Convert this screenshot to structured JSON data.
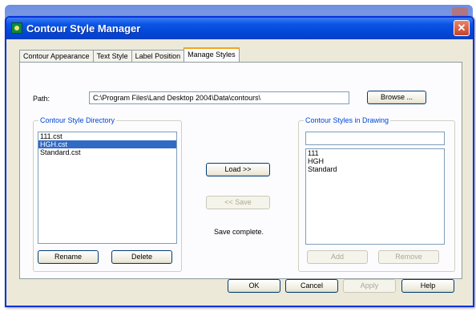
{
  "dialog": {
    "title": "Contour Style Manager",
    "close_glyph": "✕"
  },
  "tabs": [
    {
      "label": "Contour Appearance"
    },
    {
      "label": "Text Style"
    },
    {
      "label": "Label Position"
    },
    {
      "label": "Manage Styles"
    }
  ],
  "path": {
    "label": "Path:",
    "value": "C:\\Program Files\\Land Desktop 2004\\Data\\contours\\",
    "browse_label": "Browse ..."
  },
  "directory": {
    "title": "Contour Style Directory",
    "items": [
      "111.cst",
      "HGH.cst",
      "Standard.cst"
    ],
    "selected_index": 1,
    "rename_label": "Rename",
    "delete_label": "Delete"
  },
  "center": {
    "load_label": "Load >>",
    "save_label": "<< Save",
    "status": "Save complete."
  },
  "drawing": {
    "title": "Contour Styles in Drawing",
    "items": [
      "111",
      "HGH",
      "Standard"
    ],
    "add_label": "Add",
    "remove_label": "Remove"
  },
  "footer": {
    "ok_label": "OK",
    "cancel_label": "Cancel",
    "apply_label": "Apply",
    "help_label": "Help"
  }
}
